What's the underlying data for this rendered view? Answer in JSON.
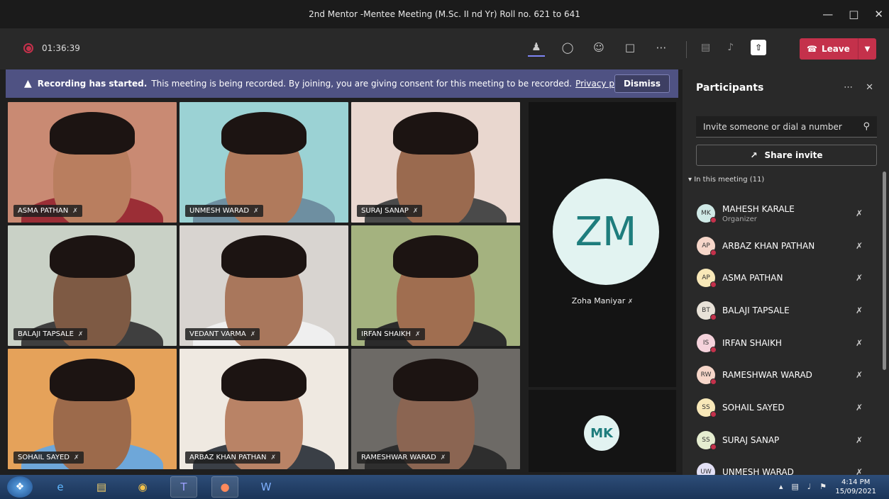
{
  "window": {
    "title": "2nd Mentor -Mentee Meeting (M.Sc. II nd Yr) Roll no. 621 to 641"
  },
  "toolbar": {
    "timer": "01:36:39",
    "leave_label": "Leave"
  },
  "banner": {
    "title": "Recording has started.",
    "message": "This meeting is being recorded. By joining, you are giving consent for this meeting to be recorded.",
    "link": "Privacy policy",
    "dismiss": "Dismiss"
  },
  "tiles": [
    {
      "name": "ASMA PATHAN",
      "bg": "#c98a73",
      "skin": "#b97e5f",
      "shirt": "#9b2e36"
    },
    {
      "name": "UNMESH WARAD",
      "bg": "#9bd2d4",
      "skin": "#b07a5c",
      "shirt": "#6e8fa1"
    },
    {
      "name": "SURAJ SANAP",
      "bg": "#e9d7cf",
      "skin": "#9a6a4f",
      "shirt": "#4a4a4a"
    },
    {
      "name": "BALAJI TAPSALE",
      "bg": "#c9d1c6",
      "skin": "#7e5a44",
      "shirt": "#3f3f3f"
    },
    {
      "name": "VEDANT VARMA",
      "bg": "#d8d4d0",
      "skin": "#a9775c",
      "shirt": "#efefef"
    },
    {
      "name": "IRFAN SHAIKH",
      "bg": "#a4b27f",
      "skin": "#a06e50",
      "shirt": "#2b2b2b"
    },
    {
      "name": "SOHAIL SAYED",
      "bg": "#e5a25a",
      "skin": "#9c6a4b",
      "shirt": "#6ea7d9"
    },
    {
      "name": "ARBAZ KHAN PATHAN",
      "bg": "#efe9e1",
      "skin": "#b98366",
      "shirt": "#3a3f46"
    },
    {
      "name": "RAMESHWAR WARAD",
      "bg": "#6d6a66",
      "skin": "#8b6552",
      "shirt": "#2e2e2e"
    }
  ],
  "spotlight": {
    "initials": "ZM",
    "name": "Zoha Maniyar"
  },
  "small_tile": {
    "initials": "MK"
  },
  "panel": {
    "title": "Participants",
    "invite_placeholder": "Invite someone or dial a number",
    "share_invite": "Share invite",
    "section": "In this meeting (11)"
  },
  "participants": [
    {
      "initials": "MK",
      "name": "MAHESH KARALE",
      "role": "Organizer",
      "color": "#cfe9e6"
    },
    {
      "initials": "AP",
      "name": "ARBAZ KHAN PATHAN",
      "role": "",
      "color": "#f6d6c9"
    },
    {
      "initials": "AP",
      "name": "ASMA PATHAN",
      "role": "",
      "color": "#f8e8b8"
    },
    {
      "initials": "BT",
      "name": "BALAJI TAPSALE",
      "role": "",
      "color": "#e8e2d8"
    },
    {
      "initials": "IS",
      "name": "IRFAN SHAIKH",
      "role": "",
      "color": "#f5d3dc"
    },
    {
      "initials": "RW",
      "name": "RAMESHWAR WARAD",
      "role": "",
      "color": "#f6d6c9"
    },
    {
      "initials": "SS",
      "name": "SOHAIL SAYED",
      "role": "",
      "color": "#f8e8b8"
    },
    {
      "initials": "SS",
      "name": "SURAJ SANAP",
      "role": "",
      "color": "#e5edd0"
    },
    {
      "initials": "UW",
      "name": "UNMESH WARAD",
      "role": "",
      "color": "#e3e0f5"
    }
  ],
  "taskbar": {
    "time": "4:14 PM",
    "date": "15/09/2021"
  }
}
